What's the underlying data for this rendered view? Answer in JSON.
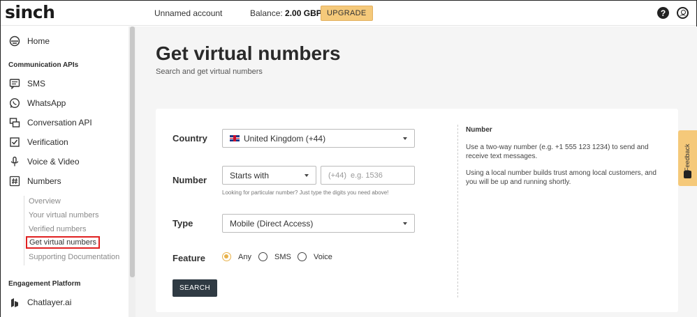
{
  "header": {
    "logo": "sinch",
    "account": "Unnamed account",
    "balance_label": "Balance:",
    "balance_value": "2.00 GBP",
    "upgrade_label": "UPGRADE",
    "help_glyph": "?"
  },
  "sidebar": {
    "home": "Home",
    "section_comm": "Communication APIs",
    "items": [
      "SMS",
      "WhatsApp",
      "Conversation API",
      "Verification",
      "Voice & Video",
      "Numbers"
    ],
    "sub_items": [
      "Overview",
      "Your virtual numbers",
      "Verified numbers",
      "Get virtual numbers",
      "Supporting Documentation"
    ],
    "section_engage": "Engagement Platform",
    "chatlayer": "Chatlayer.ai"
  },
  "page": {
    "title": "Get virtual numbers",
    "subtitle": "Search and get virtual numbers"
  },
  "form": {
    "country_label": "Country",
    "country_value": "United Kingdom (+44)",
    "number_label": "Number",
    "number_mode": "Starts with",
    "number_prefix": "(+44)",
    "number_placeholder": "e.g. 1536",
    "number_hint": "Looking for particular number? Just type the digits you need above!",
    "type_label": "Type",
    "type_value": "Mobile (Direct Access)",
    "feature_label": "Feature",
    "feature_options": [
      "Any",
      "SMS",
      "Voice"
    ],
    "feature_selected": "Any",
    "search_label": "SEARCH"
  },
  "info": {
    "title": "Number",
    "p1": "Use a two-way number (e.g. +1 555 123 1234) to send and receive text messages.",
    "p2": "Using a local number builds trust among local customers, and you will be up and running shortly."
  },
  "feedback": {
    "label": "Feedback"
  },
  "colors": {
    "accent": "#f5c97a",
    "button_dark": "#2f3a43",
    "highlight_red": "#e02020"
  }
}
